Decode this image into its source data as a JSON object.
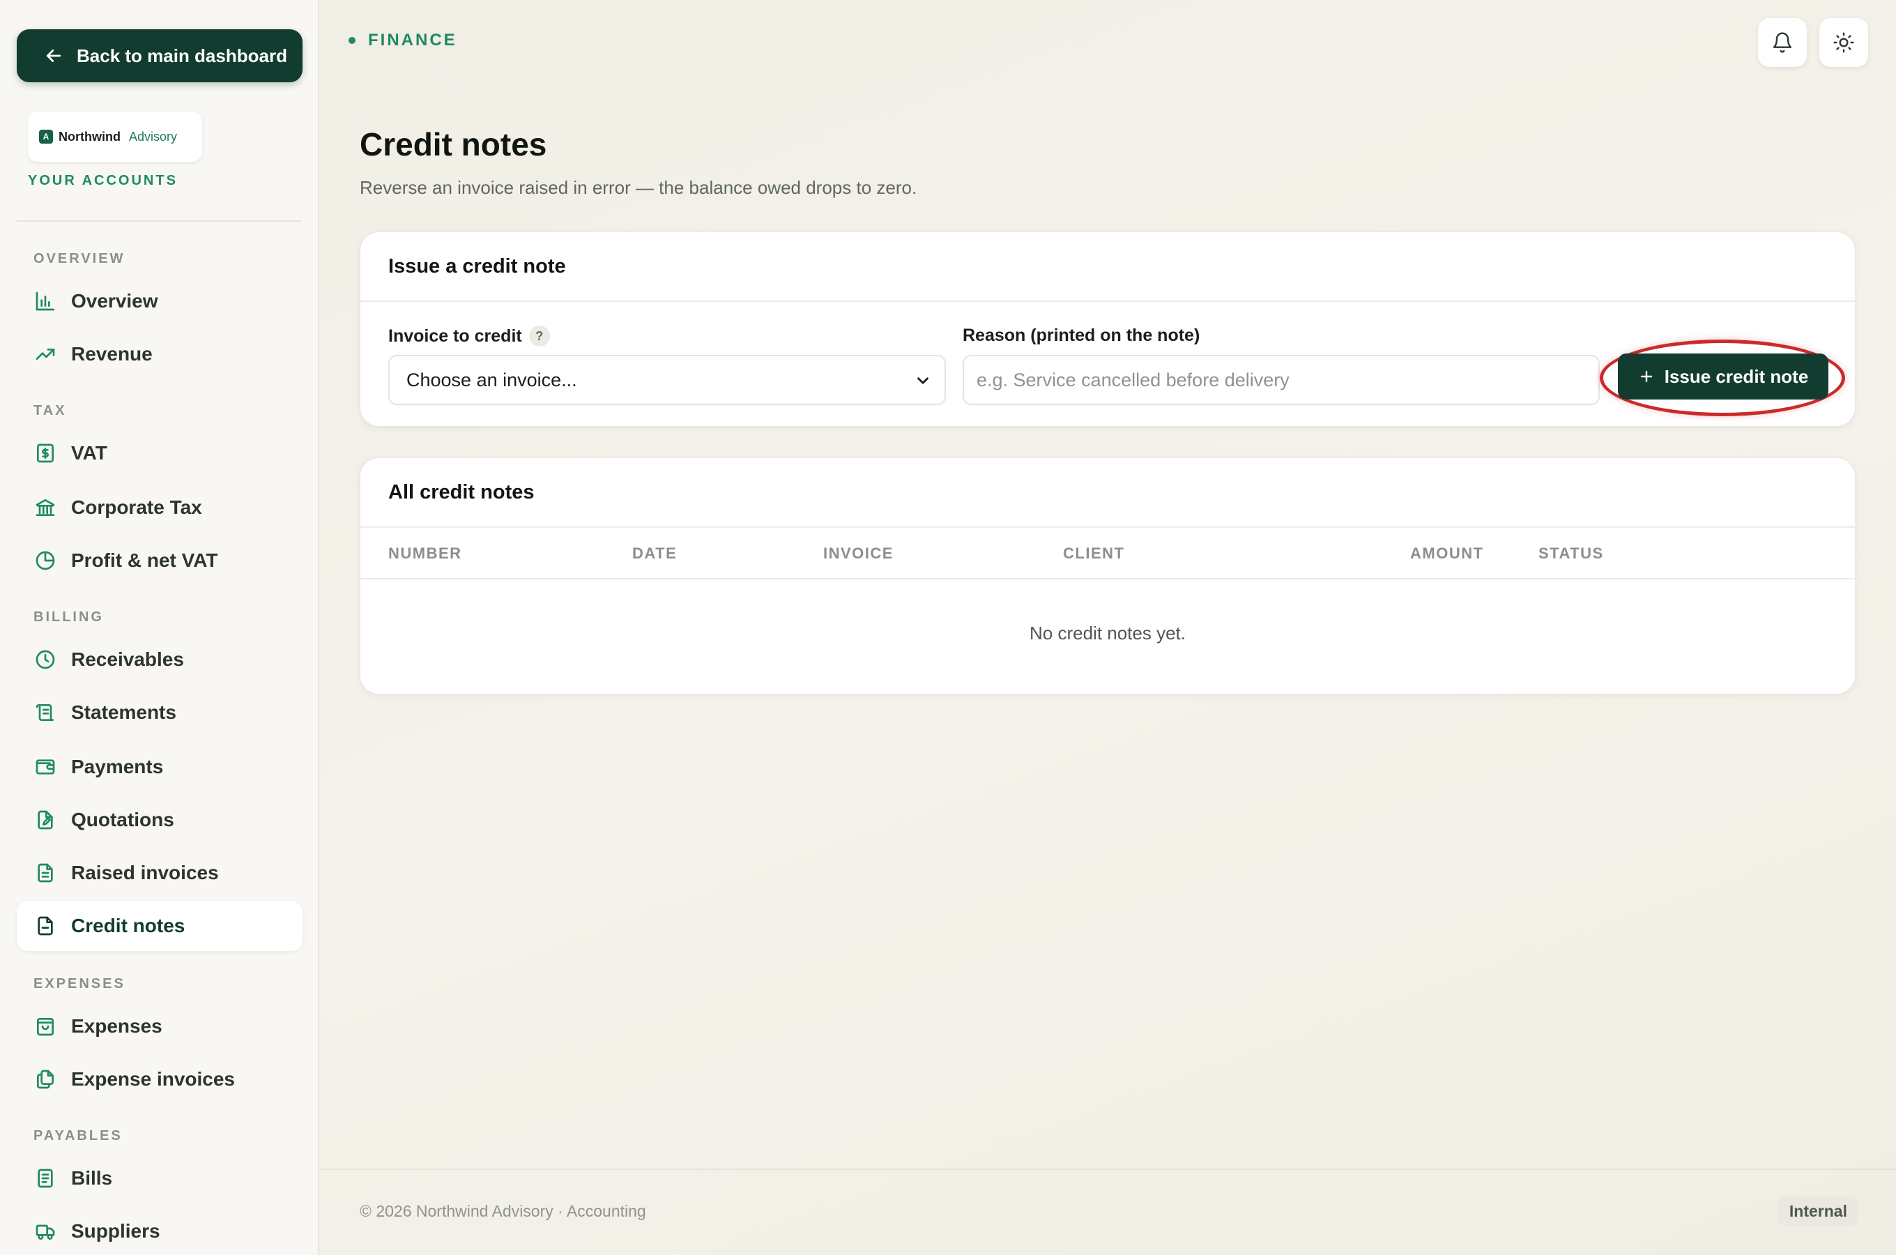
{
  "sidebar": {
    "back_label": "Back to main dashboard",
    "brand": {
      "name": "Northwind",
      "sub": "Advisory",
      "mark": "A"
    },
    "accounts_label": "YOUR ACCOUNTS",
    "sections": {
      "overview": "OVERVIEW",
      "tax": "TAX",
      "billing": "BILLING",
      "expenses": "EXPENSES",
      "payables": "PAYABLES"
    },
    "items": {
      "overview": "Overview",
      "revenue": "Revenue",
      "vat": "VAT",
      "corporate_tax": "Corporate Tax",
      "profit_net_vat": "Profit & net VAT",
      "receivables": "Receivables",
      "statements": "Statements",
      "payments": "Payments",
      "quotations": "Quotations",
      "raised_invoices": "Raised invoices",
      "credit_notes": "Credit notes",
      "expenses": "Expenses",
      "expense_invoices": "Expense invoices",
      "bills": "Bills",
      "suppliers": "Suppliers"
    },
    "active_item": "credit_notes"
  },
  "header": {
    "breadcrumb": "FINANCE",
    "icons": [
      "bell-icon",
      "sun-icon"
    ]
  },
  "page": {
    "title": "Credit notes",
    "subtitle": "Reverse an invoice raised in error — the balance owed drops to zero."
  },
  "issue_form": {
    "title": "Issue a credit note",
    "invoice_label": "Invoice to credit",
    "help_glyph": "?",
    "invoice_select_value": "Choose an invoice...",
    "reason_label": "Reason (printed on the note)",
    "reason_placeholder": "e.g. Service cancelled before delivery",
    "reason_value": "",
    "submit_label": "Issue credit note",
    "highlight_color": "#cc2a2a"
  },
  "credit_notes_list": {
    "title": "All credit notes",
    "columns": [
      "NUMBER",
      "DATE",
      "INVOICE",
      "CLIENT",
      "AMOUNT",
      "STATUS"
    ],
    "rows": [],
    "empty_message": "No credit notes yet."
  },
  "footer": {
    "copyright": "© 2026 Northwind Advisory · Accounting",
    "badge": "Internal"
  },
  "colors": {
    "brand_dark": "#123c30",
    "accent_green": "#1e8a64"
  }
}
